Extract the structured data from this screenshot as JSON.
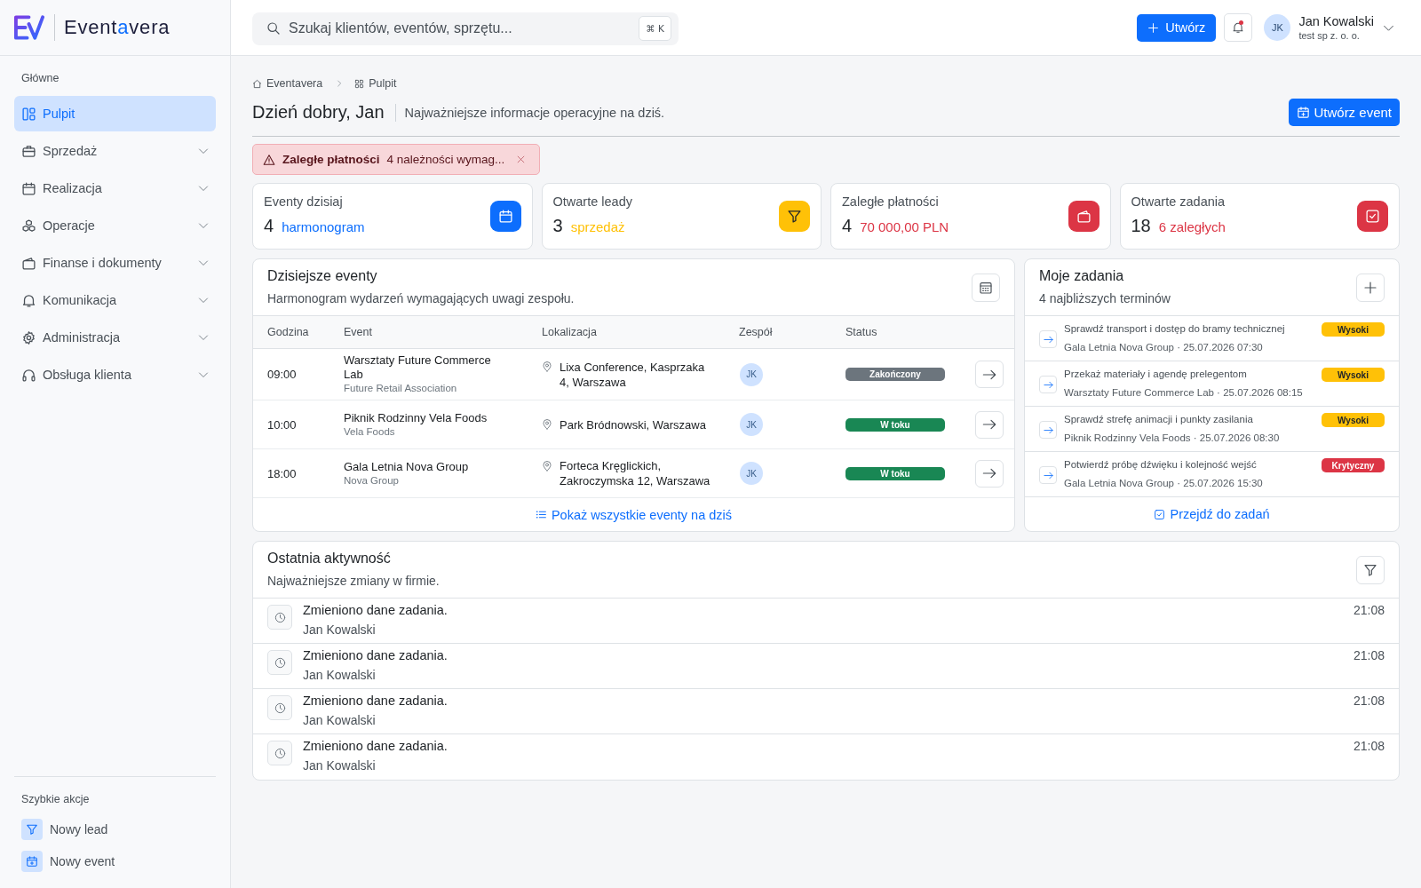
{
  "brand": {
    "name": "Eventavera"
  },
  "search": {
    "placeholder": "Szukaj klientów, eventów, sprzętu...",
    "shortcut": "⌘ K"
  },
  "topbar": {
    "create_button": "Utwórz",
    "notifications": {
      "unread": true
    },
    "user": {
      "initials": "JK",
      "name": "Jan Kowalski",
      "company": "test sp z. o. o."
    }
  },
  "sidebar": {
    "section": "Główne",
    "items": [
      {
        "label": "Pulpit",
        "kind": "link",
        "selected": true
      },
      {
        "label": "Sprzedaż",
        "kind": "group",
        "selected": false,
        "expanded": false
      },
      {
        "label": "Realizacja",
        "kind": "group",
        "selected": false,
        "expanded": false
      },
      {
        "label": "Operacje",
        "kind": "group",
        "selected": false,
        "expanded": false
      },
      {
        "label": "Finanse i dokumenty",
        "kind": "group",
        "selected": false,
        "expanded": false
      },
      {
        "label": "Komunikacja",
        "kind": "group",
        "selected": false,
        "expanded": false
      },
      {
        "label": "Administracja",
        "kind": "group",
        "selected": false,
        "expanded": false
      },
      {
        "label": "Obsługa klienta",
        "kind": "group",
        "selected": false,
        "expanded": false
      }
    ],
    "quick_actions": {
      "title": "Szybkie akcje",
      "items": [
        "Nowy lead",
        "Nowy event"
      ]
    }
  },
  "breadcrumb": [
    "Eventavera",
    "Pulpit"
  ],
  "header": {
    "title": "Dzień dobry, Jan",
    "subtitle": "Najważniejsze informacje operacyjne na dziś.",
    "action": "Utwórz event"
  },
  "alert": {
    "title": "Zaległe płatności",
    "message": "4 należności wymag..."
  },
  "stats": [
    {
      "label": "Eventy dzisiaj",
      "value": "4",
      "note": "harmonogram",
      "color": "#0d6efd"
    },
    {
      "label": "Otwarte leady",
      "value": "3",
      "note": "sprzedaż",
      "color": "#ffc107"
    },
    {
      "label": "Zaległe płatności",
      "value": "4",
      "note": "70 000,00 PLN",
      "color": "#dc3545"
    },
    {
      "label": "Otwarte zadania",
      "value": "18",
      "note": "6 zaległych",
      "color": "#dc3545"
    }
  ],
  "events": {
    "title": "Dzisiejsze eventy",
    "subtitle": "Harmonogram wydarzeń wymagających uwagi zespołu.",
    "columns": [
      "Godzina",
      "Event",
      "Lokalizacja",
      "Zespół",
      "Status"
    ],
    "rows": [
      {
        "time": "09:00",
        "event": "Warsztaty Future Commerce Lab",
        "client": "Future Retail Association",
        "location": "Lixa Conference, Kasprzaka 4, Warszawa",
        "team": [
          "JK"
        ],
        "status": {
          "label": "Zakończony",
          "color": "#6c757d"
        }
      },
      {
        "time": "10:00",
        "event": "Piknik Rodzinny Vela Foods",
        "client": "Vela Foods",
        "location": "Park Bródnowski, Warszawa",
        "team": [
          "JK"
        ],
        "status": {
          "label": "W toku",
          "color": "#198754"
        }
      },
      {
        "time": "18:00",
        "event": "Gala Letnia Nova Group",
        "client": "Nova Group",
        "location": "Forteca Kręglickich, Zakroczymska 12, Warszawa",
        "team": [
          "JK"
        ],
        "status": {
          "label": "W toku",
          "color": "#198754"
        }
      }
    ],
    "footer_link": "Pokaż wszystkie eventy na dziś"
  },
  "tasks": {
    "title": "Moje zadania",
    "subtitle": "4 najbliższych terminów",
    "items": [
      {
        "title": "Sprawdź transport i dostęp do bramy technicznej",
        "meta": "Gala Letnia Nova Group · 25.07.2026 07:30",
        "priority": {
          "label": "Wysoki",
          "color": "#ffc107"
        }
      },
      {
        "title": "Przekaż materiały i agendę prelegentom",
        "meta": "Warsztaty Future Commerce Lab · 25.07.2026 08:15",
        "priority": {
          "label": "Wysoki",
          "color": "#ffc107"
        }
      },
      {
        "title": "Sprawdź strefę animacji i punkty zasilania",
        "meta": "Piknik Rodzinny Vela Foods · 25.07.2026 08:30",
        "priority": {
          "label": "Wysoki",
          "color": "#ffc107"
        }
      },
      {
        "title": "Potwierdź próbę dźwięku i kolejność wejść",
        "meta": "Gala Letnia Nova Group · 25.07.2026 15:30",
        "priority": {
          "label": "Krytyczny",
          "color": "#dc3545"
        }
      }
    ],
    "footer_link": "Przejdź do zadań"
  },
  "activity": {
    "title": "Ostatnia aktywność",
    "subtitle": "Najważniejsze zmiany w firmie.",
    "items": [
      {
        "text": "Zmieniono dane zadania.",
        "author": "Jan Kowalski",
        "time": "21:08"
      },
      {
        "text": "Zmieniono dane zadania.",
        "author": "Jan Kowalski",
        "time": "21:08"
      },
      {
        "text": "Zmieniono dane zadania.",
        "author": "Jan Kowalski",
        "time": "21:08"
      },
      {
        "text": "Zmieniono dane zadania.",
        "author": "Jan Kowalski",
        "time": "21:08"
      }
    ]
  }
}
